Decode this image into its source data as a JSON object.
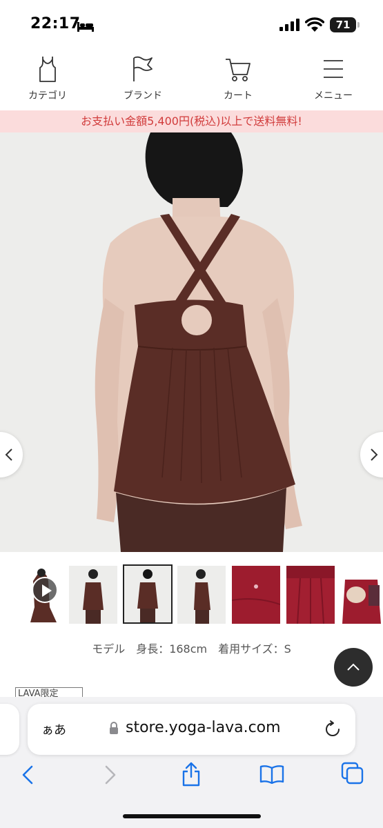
{
  "status_bar": {
    "time": "22:17",
    "battery": "71",
    "icons": [
      "sleep-bed-icon",
      "signal-icon",
      "wifi-icon",
      "battery-icon"
    ]
  },
  "header": {
    "nav": [
      {
        "label": "カテゴリ",
        "icon": "tank-top-icon"
      },
      {
        "label": "ブランド",
        "icon": "flag-icon"
      },
      {
        "label": "カート",
        "icon": "cart-icon"
      },
      {
        "label": "メニュー",
        "icon": "hamburger-menu-icon"
      }
    ]
  },
  "promo": {
    "text": "お支払い金額5,400円(税込)以上で送料無料!",
    "color": "#d13b3b",
    "background": "#fbdcdc"
  },
  "gallery": {
    "thumbnail_count": 7,
    "selected_index": 2,
    "first_is_video": true
  },
  "model_info": "モデル　身長：168cm　着用サイズ：S",
  "badge": "LAVA限定",
  "browser": {
    "aa_label": "ぁあ",
    "url": "store.yoga-lava.com",
    "toolbar_icons": [
      "back-icon",
      "forward-icon",
      "share-icon",
      "bookmarks-icon",
      "tabs-icon"
    ],
    "accent": "#1a73e8"
  },
  "colors": {
    "garment": "#5a2d26",
    "alt_garment": "#9d1c2e"
  }
}
